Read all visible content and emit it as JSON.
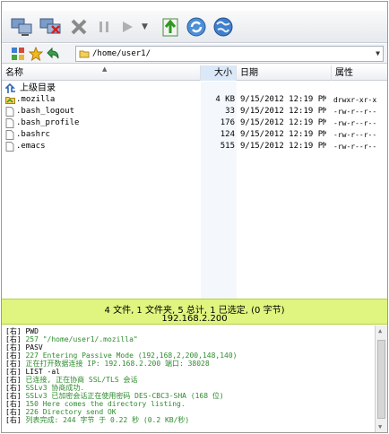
{
  "toolbar": {
    "buttons": [
      "connect-icon",
      "disconnect-icon",
      "cancel-icon",
      "pause-icon",
      "play-icon",
      "upload-icon",
      "refresh-icon",
      "globe-icon"
    ]
  },
  "path": {
    "value": "/home/user1/"
  },
  "columns": {
    "name": "名称",
    "size": "大小",
    "date": "日期",
    "perm": "属性"
  },
  "files": {
    "up": "上级目录",
    "rows": [
      {
        "name": ".mozilla",
        "size": "4 KB",
        "date": "9/15/2012 12:19 PM",
        "perm": "drwxr-xr-x",
        "type": "folder"
      },
      {
        "name": ".bash_logout",
        "size": "33",
        "date": "9/15/2012 12:19 PM",
        "perm": "-rw-r--r--",
        "type": "file"
      },
      {
        "name": ".bash_profile",
        "size": "176",
        "date": "9/15/2012 12:19 PM",
        "perm": "-rw-r--r--",
        "type": "file"
      },
      {
        "name": ".bashrc",
        "size": "124",
        "date": "9/15/2012 12:19 PM",
        "perm": "-rw-r--r--",
        "type": "file"
      },
      {
        "name": ".emacs",
        "size": "515",
        "date": "9/15/2012 12:19 PM",
        "perm": "-rw-r--r--",
        "type": "file"
      }
    ]
  },
  "status": {
    "line1": "4 文件, 1 文件夹, 5 总计, 1 已选定, (0 字节)",
    "line2": "192.168.2.200"
  },
  "log": [
    {
      "tag": "[右]",
      "msg": "PWD",
      "kind": "left"
    },
    {
      "tag": "[右]",
      "msg": "257 \"/home/user1/.mozilla\"",
      "kind": "right"
    },
    {
      "tag": "[右]",
      "msg": "PASV",
      "kind": "left"
    },
    {
      "tag": "[右]",
      "msg": "227 Entering Passive Mode (192,168,2,200,148,140)",
      "kind": "right"
    },
    {
      "tag": "[右]",
      "msg": "正在打开数据连接 IP: 192.168.2.200 端口: 38028",
      "kind": "right"
    },
    {
      "tag": "[右]",
      "msg": "LIST -al",
      "kind": "left"
    },
    {
      "tag": "[右]",
      "msg": "已连接, 正在协商 SSL/TLS 会话",
      "kind": "right"
    },
    {
      "tag": "[右]",
      "msg": "SSLv3 协商成功.",
      "kind": "right"
    },
    {
      "tag": "[右]",
      "msg": "SSLv3 已加密会话正在使用密码 DES-CBC3-SHA (168 位)",
      "kind": "right"
    },
    {
      "tag": "[右]",
      "msg": "150 Here comes the directory listing.",
      "kind": "right"
    },
    {
      "tag": "[右]",
      "msg": "226 Directory send OK",
      "kind": "right"
    },
    {
      "tag": "[右]",
      "msg": "列表完成: 244 字节 于 0.22 秒 (0.2 KB/秒)",
      "kind": "right"
    }
  ]
}
